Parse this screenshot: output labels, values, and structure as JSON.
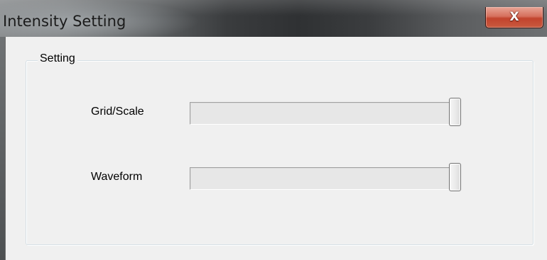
{
  "window": {
    "title": "Intensity Setting",
    "close_glyph": "X",
    "close_icon": "close-icon",
    "accent_close": "#c94b33"
  },
  "group": {
    "caption": "Setting",
    "sliders": [
      {
        "label": "Grid/Scale",
        "level_percent": 100
      },
      {
        "label": "Waveform",
        "level_percent": 100
      }
    ]
  }
}
